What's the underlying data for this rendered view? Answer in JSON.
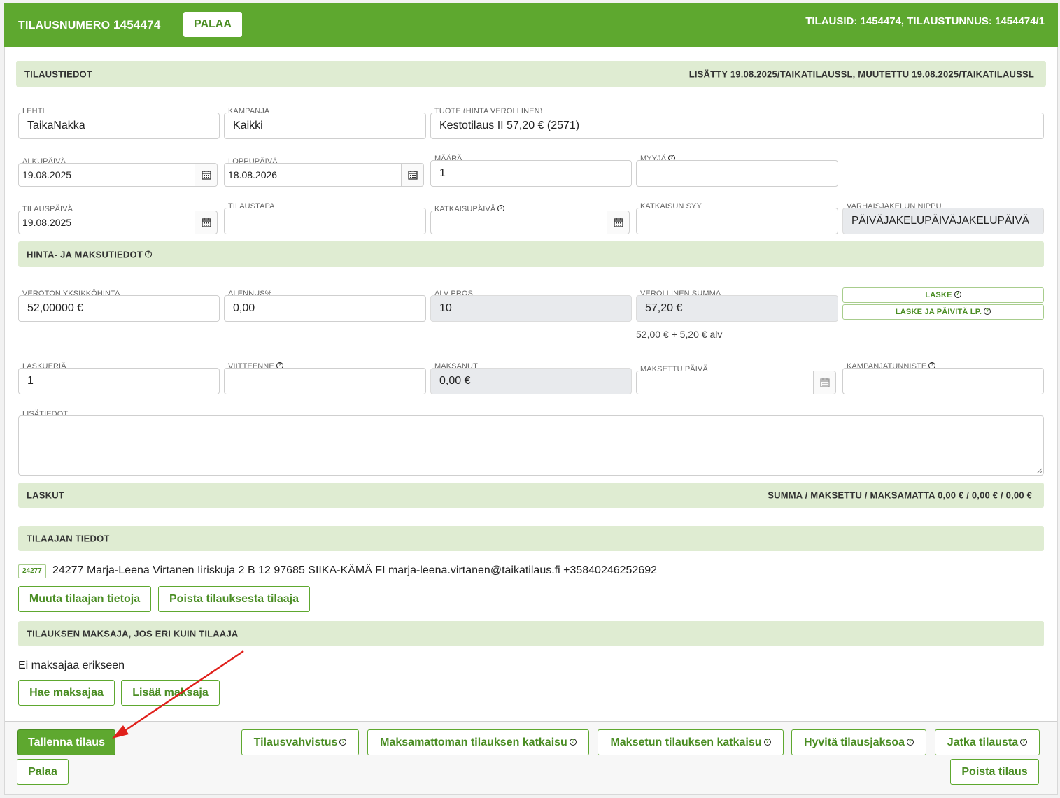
{
  "header": {
    "title_prefix": "TILAUSNUMERO",
    "order_number": "1454474",
    "back_button": "PALAA",
    "right_info": "TILAUSID: 1454474, TILAUSTUNNUS: 1454474/1"
  },
  "order_info": {
    "title": "TILAUSTIEDOT",
    "meta": "LISÄTTY 19.08.2025/TAIKATILAUSSL, MUUTETTU 19.08.2025/TAIKATILAUSSL",
    "lehti": {
      "label": "LEHTI",
      "value": "TaikaNakka"
    },
    "kampanja": {
      "label": "KAMPANJA",
      "value": "Kaikki"
    },
    "tuote": {
      "label": "TUOTE (HINTA VEROLLINEN)",
      "value": "Kestotilaus II 57,20 € (2571)"
    },
    "alkupaiva": {
      "label": "ALKUPÄIVÄ",
      "value": "19.08.2025"
    },
    "loppupaiva": {
      "label": "LOPPUPÄIVÄ",
      "value": "18.08.2026"
    },
    "maara": {
      "label": "MÄÄRÄ",
      "value": "1"
    },
    "myyja": {
      "label": "MYYJÄ",
      "value": ""
    },
    "tilauspaiva": {
      "label": "TILAUSPÄIVÄ",
      "value": "19.08.2025"
    },
    "tilaustapa": {
      "label": "TILAUSTAPA",
      "value": ""
    },
    "katkaisupaiva": {
      "label": "KATKAISUPÄIVÄ",
      "value": ""
    },
    "katkaisun_syy": {
      "label": "KATKAISUN SYY",
      "value": ""
    },
    "varhaisjakelu": {
      "label": "VARHAISJAKELUN NIPPU",
      "value": "PÄIVÄJAKELUPÄIVÄJAKELUPÄIVÄ"
    }
  },
  "price": {
    "title": "HINTA- JA MAKSUTIEDOT",
    "veroton": {
      "label": "VEROTON YKSIKKÖHINTA",
      "value": "52,00000 €"
    },
    "alennus": {
      "label": "ALENNUS%",
      "value": "0,00"
    },
    "alv": {
      "label": "ALV PROS",
      "value": "10"
    },
    "verollinen": {
      "label": "VEROLLINEN SUMMA",
      "value": "57,20 €"
    },
    "breakdown": "52,00 € + 5,20 € alv",
    "laske": "LASKE",
    "laske_paivita": "LASKE JA PÄIVITÄ LP.",
    "laskueria": {
      "label": "LASKUERIÄ",
      "value": "1"
    },
    "viitteenne": {
      "label": "VIITTEENNE",
      "value": ""
    },
    "maksanut": {
      "label": "MAKSANUT",
      "value": "0,00 €"
    },
    "maksettu_paiva": {
      "label": "MAKSETTU PÄIVÄ",
      "value": ""
    },
    "kampanjatunniste": {
      "label": "KAMPANJATUNNISTE",
      "value": ""
    },
    "lisatiedot": {
      "label": "LISÄTIEDOT",
      "value": ""
    }
  },
  "invoices": {
    "title": "LASKUT",
    "summary": "SUMMA / MAKSETTU / MAKSAMATTA 0,00 € / 0,00 € / 0,00 €"
  },
  "customer": {
    "title": "TILAAJAN TIEDOT",
    "badge": "24277",
    "details": "24277 Marja-Leena Virtanen Iiriskuja 2 B 12 97685 SIIKA-KÄMÄ FI marja-leena.virtanen@taikatilaus.fi +35840246252692",
    "edit_button": "Muuta tilaajan tietoja",
    "remove_button": "Poista tilauksesta tilaaja"
  },
  "payer": {
    "title": "TILAUKSEN MAKSAJA, JOS ERI KUIN TILAAJA",
    "none_text": "Ei maksajaa erikseen",
    "find_button": "Hae maksajaa",
    "add_button": "Lisää maksaja"
  },
  "footer": {
    "save": "Tallenna tilaus",
    "back": "Palaa",
    "confirm": "Tilausvahvistus",
    "cancel_unpaid": "Maksamattoman tilauksen katkaisu",
    "cancel_paid": "Maksetun tilauksen katkaisu",
    "credit": "Hyvitä tilausjaksoa",
    "continue": "Jatka tilausta",
    "delete": "Poista tilaus"
  },
  "colors": {
    "brand": "#5ea82f",
    "section": "#dfecd2",
    "arrow": "#e0201b"
  }
}
